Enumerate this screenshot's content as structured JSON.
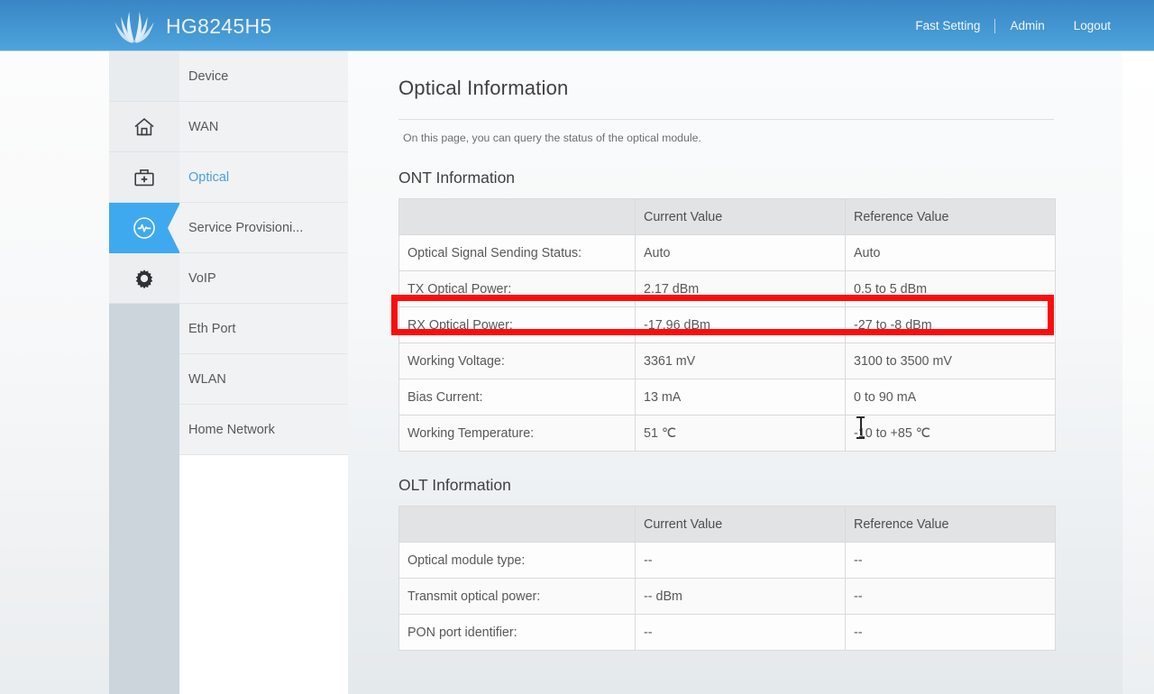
{
  "header": {
    "brand_title": "HG8245H5",
    "logo_icon": "huawei-flower-logo",
    "nav": [
      {
        "label": "Fast Setting",
        "name": "fast-setting"
      },
      {
        "label": "Admin",
        "name": "admin"
      },
      {
        "label": "Logout",
        "name": "logout"
      }
    ]
  },
  "sidebar": {
    "icons": [
      {
        "name": "blank-top",
        "icon": "none",
        "active": false
      },
      {
        "name": "home-icon",
        "icon": "home",
        "active": false
      },
      {
        "name": "maintenance-kit-icon",
        "icon": "med-kit",
        "active": false
      },
      {
        "name": "status-pulse-icon",
        "icon": "pulse-circle",
        "active": true
      },
      {
        "name": "gear-icon",
        "icon": "gear",
        "active": false
      }
    ],
    "items": [
      {
        "label": "Device",
        "current": false
      },
      {
        "label": "WAN",
        "current": false
      },
      {
        "label": "Optical",
        "current": true
      },
      {
        "label": "Service Provisioni...",
        "current": false
      },
      {
        "label": "VoIP",
        "current": false
      },
      {
        "label": "Eth Port",
        "current": false
      },
      {
        "label": "WLAN",
        "current": false
      },
      {
        "label": "Home Network",
        "current": false
      }
    ]
  },
  "main": {
    "page_title": "Optical Information",
    "page_description": "On this page, you can query the status of the optical module.",
    "ont": {
      "section_title": "ONT Information",
      "columns": [
        "",
        "Current Value",
        "Reference Value"
      ],
      "rows": [
        {
          "label": "Optical Signal Sending Status:",
          "current": "Auto",
          "reference": "Auto"
        },
        {
          "label": "TX Optical Power:",
          "current": "2.17 dBm",
          "reference": "0.5 to 5 dBm"
        },
        {
          "label": "RX Optical Power:",
          "current": "-17.96 dBm",
          "reference": "-27 to -8 dBm"
        },
        {
          "label": "Working Voltage:",
          "current": "3361 mV",
          "reference": "3100 to 3500 mV"
        },
        {
          "label": "Bias Current:",
          "current": "13 mA",
          "reference": "0 to 90 mA"
        },
        {
          "label": "Working Temperature:",
          "current": "51 ℃",
          "reference": "-10 to +85 ℃"
        }
      ]
    },
    "olt": {
      "section_title": "OLT Information",
      "columns": [
        "",
        "Current Value",
        "Reference Value"
      ],
      "rows": [
        {
          "label": "Optical module type:",
          "current": "--",
          "reference": "--"
        },
        {
          "label": "Transmit optical power:",
          "current": "-- dBm",
          "reference": "--"
        },
        {
          "label": "PON port identifier:",
          "current": "--",
          "reference": "--"
        }
      ]
    }
  },
  "annotation": {
    "highlight_row_label": "RX Optical Power:",
    "highlight_color": "#fc0d0d"
  },
  "colors": {
    "header_blue": "#4294d0",
    "accent_blue": "#3fa9f0",
    "link_blue": "#4a9fe0",
    "table_header_gray": "#e2e3e4"
  }
}
